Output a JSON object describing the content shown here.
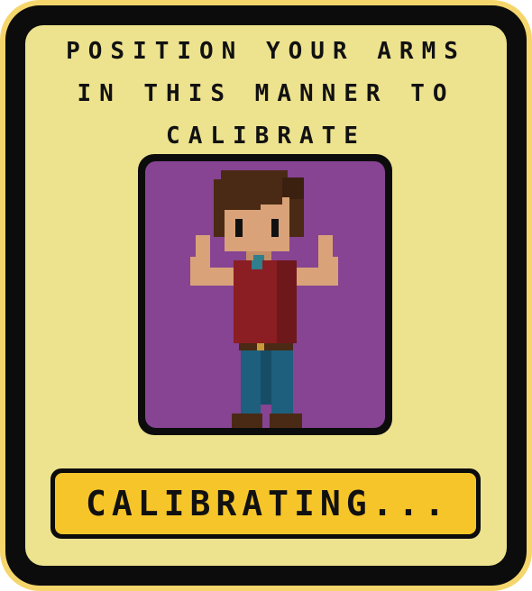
{
  "instructions": {
    "line1": "POSITION YOUR ARMS",
    "line2": "IN THIS MANNER TO",
    "line3": "CALIBRATE"
  },
  "portrait": {
    "icon": "flexing-character-icon",
    "background_color": "#864493"
  },
  "status": {
    "label": "CALIBRATING..."
  },
  "colors": {
    "frame_outer": "#f5d66c",
    "frame_border": "#0c0c0c",
    "panel": "#ede28e",
    "status_fill": "#f6c52a"
  }
}
